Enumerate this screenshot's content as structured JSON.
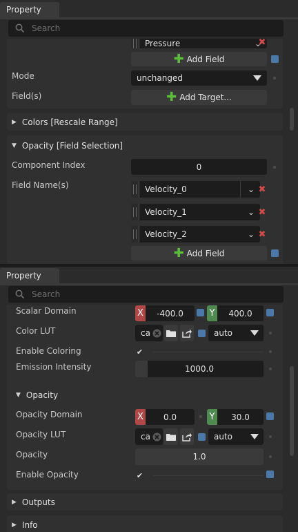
{
  "top_panel": {
    "tab": "Property",
    "search_placeholder": "Search",
    "pressure_field": "Pressure",
    "add_field_1": "Add Field",
    "mode_label": "Mode",
    "mode_value": "unchanged",
    "fields_label": "Field(s)",
    "add_target": "Add Target...",
    "colors_section": "Colors [Rescale Range]",
    "opacity_section": "Opacity [Field Selection]",
    "component_index_label": "Component Index",
    "component_index_value": "0",
    "field_names_label": "Field Name(s)",
    "fields": [
      "Velocity_0",
      "Velocity_1",
      "Velocity_2"
    ],
    "add_field_2": "Add Field"
  },
  "bottom_panel": {
    "tab": "Property",
    "search_placeholder": "Search",
    "scalar_domain_label": "Scalar Domain",
    "scalar_x": "-400.0",
    "scalar_y": "400.0",
    "x_tag": "X",
    "y_tag": "Y",
    "color_lut_label": "Color LUT",
    "color_lut_value": "ca",
    "color_lut_mode": "auto",
    "enable_coloring_label": "Enable Coloring",
    "emission_label": "Emission Intensity",
    "emission_value": "1000.0",
    "opacity_header": "Opacity",
    "opacity_domain_label": "Opacity Domain",
    "opacity_x": "0.0",
    "opacity_y": "30.0",
    "opacity_lut_label": "Opacity LUT",
    "opacity_lut_value": "ca",
    "opacity_lut_mode": "auto",
    "opacity_label": "Opacity",
    "opacity_value": "1.0",
    "enable_opacity_label": "Enable Opacity",
    "outputs_section": "Outputs",
    "info_section": "Info"
  },
  "colors": {
    "accent_blue": "#4a78a8",
    "add_green": "#5cbf3a",
    "remove_red": "#d24a4a",
    "x_red": "#b04848",
    "y_green": "#4f8a4f"
  }
}
